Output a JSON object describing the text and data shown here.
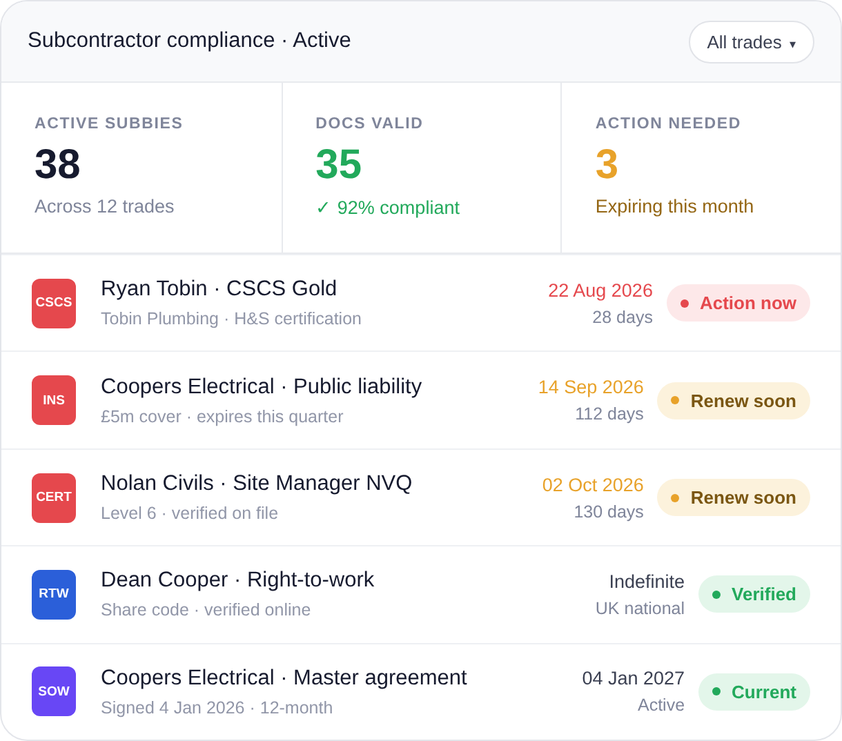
{
  "header": {
    "title": "Subcontractor compliance · Active",
    "filter": {
      "label": "All trades",
      "caret": "▾"
    }
  },
  "stats": [
    {
      "label": "ACTIVE SUBBIES",
      "value": "38",
      "note": "Across 12 trades",
      "kind": "neutral"
    },
    {
      "label": "DOCS VALID",
      "value": "35",
      "note": "✓ 92% compliant",
      "kind": "good"
    },
    {
      "label": "ACTION NEEDED",
      "value": "3",
      "note": "Expiring this month",
      "kind": "warn"
    }
  ],
  "rows": [
    {
      "tag": "CSCS",
      "color": "#e5484d",
      "title": "Ryan Tobin · CSCS Gold",
      "subtitle": "Tobin Plumbing · H&S certification",
      "date": "22 Aug 2026",
      "remaining": "28 days",
      "status": {
        "kind": "danger",
        "label": "Action now"
      }
    },
    {
      "tag": "INS",
      "color": "#e5484d",
      "title": "Coopers Electrical · Public liability",
      "subtitle": "£5m cover · expires this quarter",
      "date": "14 Sep 2026",
      "remaining": "112 days",
      "status": {
        "kind": "warning",
        "label": "Renew soon"
      }
    },
    {
      "tag": "CERT",
      "color": "#e5484d",
      "title": "Nolan Civils · Site Manager NVQ",
      "subtitle": "Level 6 · verified on file",
      "date": "02 Oct 2026",
      "remaining": "130 days",
      "status": {
        "kind": "warning",
        "label": "Renew soon"
      }
    },
    {
      "tag": "RTW",
      "color": "#2b5fd9",
      "title": "Dean Cooper · Right-to-work",
      "subtitle": "Share code · verified online",
      "date": "Indefinite",
      "remaining": "UK national",
      "status": {
        "kind": "success",
        "label": "Verified"
      }
    },
    {
      "tag": "SOW",
      "color": "#6847f5",
      "title": "Coopers Electrical · Master agreement",
      "subtitle": "Signed 4 Jan 2026 · 12-month",
      "date": "04 Jan 2027",
      "remaining": "Active",
      "status": {
        "kind": "success",
        "label": "Current"
      }
    }
  ]
}
